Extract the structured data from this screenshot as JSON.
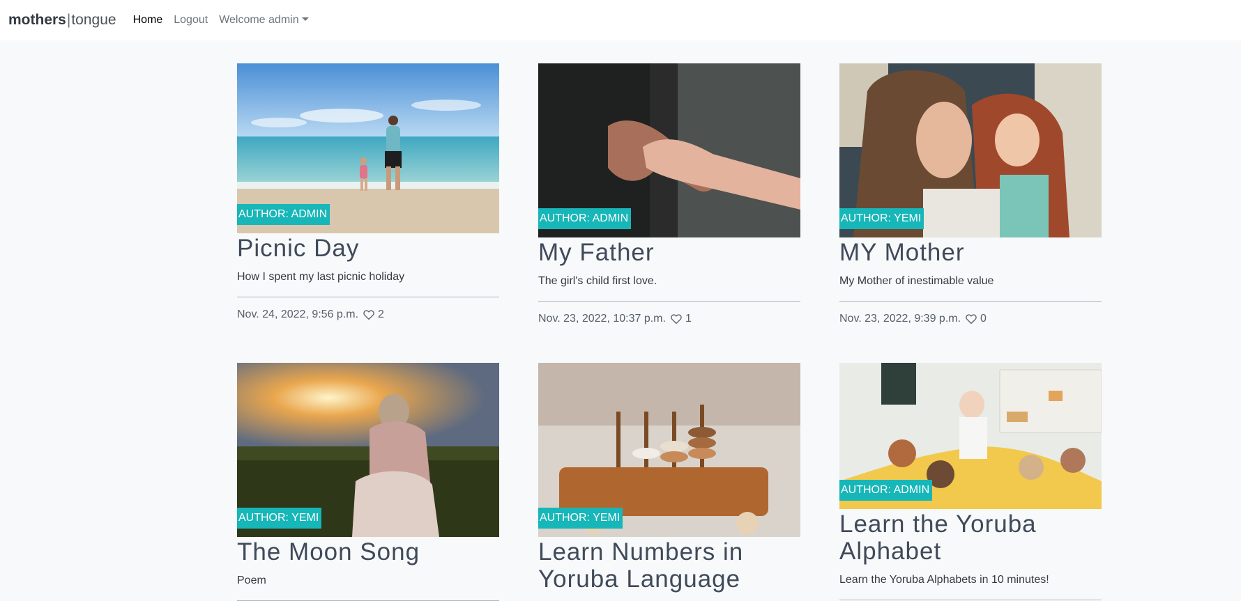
{
  "navbar": {
    "brand_bold": "mothers",
    "brand_sep": "|",
    "brand_light": "tongue",
    "links": [
      {
        "label": "Home"
      },
      {
        "label": "Logout"
      },
      {
        "label": "Welcome admin"
      }
    ]
  },
  "posts": [
    {
      "author_label": "Author: admin",
      "title": "Picnic Day",
      "description": "How I spent my last picnic holiday",
      "date": "Nov. 24, 2022, 9:56 p.m.",
      "likes": "2",
      "image": "beach-father-child-photo"
    },
    {
      "author_label": "Author: admin",
      "title": "My Father",
      "description": "The girl's child first love.",
      "date": "Nov. 23, 2022, 10:37 p.m.",
      "likes": "1",
      "image": "hands-photo"
    },
    {
      "author_label": "Author: yemi",
      "title": "MY Mother",
      "description": "My Mother of inestimable value",
      "date": "Nov. 23, 2022, 9:39 p.m.",
      "likes": "0",
      "image": "mother-daughter-photo"
    },
    {
      "author_label": "Author: yemi",
      "title": "The Moon Song",
      "description": "Poem",
      "image": "sunset-field-photo"
    },
    {
      "author_label": "Author: yemi",
      "title": "Learn Numbers in Yoruba Language",
      "image": "wooden-numbers-toy-photo"
    },
    {
      "author_label": "Author: admin",
      "title": "Learn the Yoruba Alphabet",
      "description": "Learn the Yoruba Alphabets in 10 minutes!",
      "image": "classroom-photo"
    }
  ],
  "colors": {
    "badge": "#17b6b8",
    "title": "#3f4a5a",
    "page_bg": "#f8f9fa"
  }
}
